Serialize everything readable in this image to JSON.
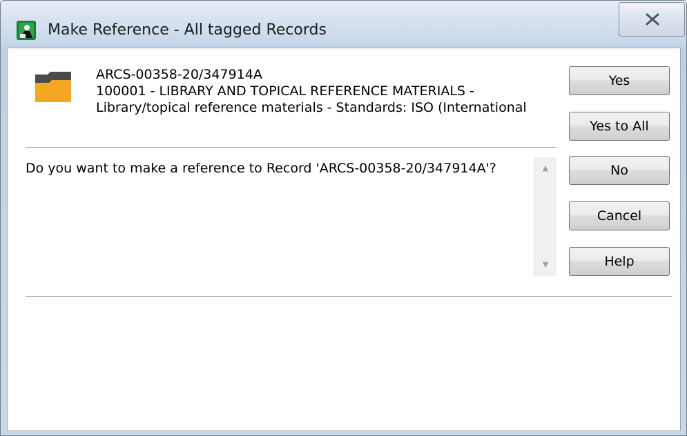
{
  "window": {
    "title": "Make Reference - All tagged Records"
  },
  "record": {
    "number": "ARCS-00358-20/347914A",
    "classification": "100001 - LIBRARY AND TOPICAL REFERENCE MATERIALS -",
    "title_line": "Library/topical reference materials - Standards: ISO (International"
  },
  "message": {
    "question": "Do you want to make a reference to Record 'ARCS-00358-20/347914A'?"
  },
  "buttons": {
    "yes": "Yes",
    "yes_to_all": "Yes to All",
    "no": "No",
    "cancel": "Cancel",
    "help": "Help"
  },
  "icons": {
    "app": "app-icon",
    "folder": "folder-icon",
    "close": "close-icon",
    "scroll_up": "scroll-up-arrow-icon",
    "scroll_down": "scroll-down-arrow-icon"
  },
  "colors": {
    "folder_body": "#f5a623",
    "folder_back": "#4a4a4a"
  }
}
